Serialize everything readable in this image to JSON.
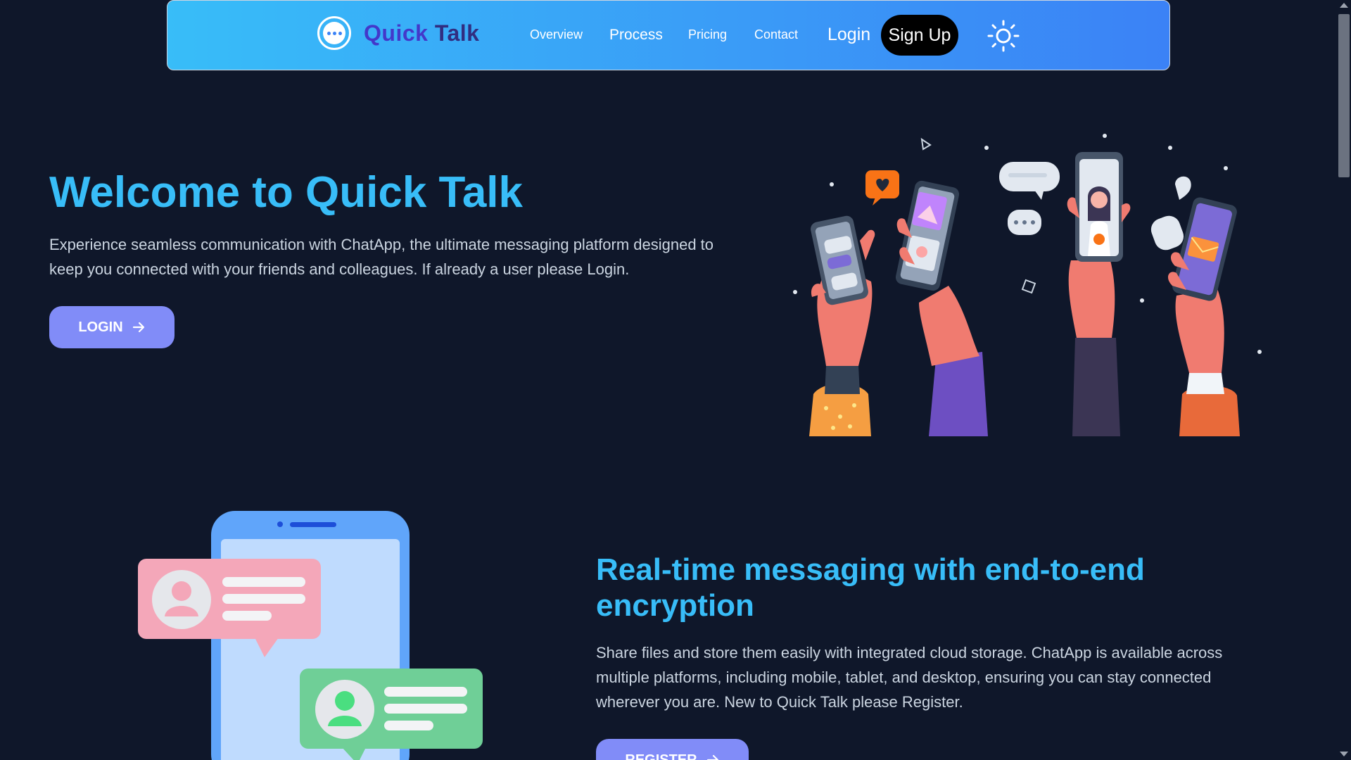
{
  "nav": {
    "brand_part1": "Quick",
    "brand_part2": "Talk",
    "links": [
      "Overview",
      "Process",
      "Pricing",
      "Contact"
    ],
    "login": "Login",
    "signup": "Sign Up",
    "theme_icon": "sun-icon"
  },
  "hero": {
    "title": "Welcome to Quick Talk",
    "description": "Experience seamless communication with ChatApp, the ultimate messaging platform designed to keep you connected with your friends and colleagues. If already a user please Login.",
    "button": "LOGIN"
  },
  "features": {
    "title": "Real-time messaging with end-to-end encryption",
    "description": "Share files and store them easily with integrated cloud storage. ChatApp is available across multiple platforms, including mobile, tablet, and desktop, ensuring you can stay connected wherever you are. New to Quick Talk please Register.",
    "button": "REGISTER"
  },
  "colors": {
    "background": "#0f172a",
    "accent": "#38bdf8",
    "button": "#818cf8"
  }
}
